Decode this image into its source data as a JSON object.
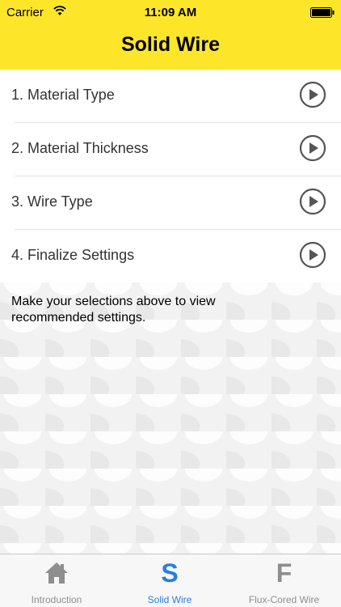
{
  "status": {
    "carrier": "Carrier",
    "time": "11:09 AM"
  },
  "header": {
    "title": "Solid Wire",
    "color": "#fde62a"
  },
  "steps": [
    {
      "label": "1. Material Type"
    },
    {
      "label": "2. Material Thickness"
    },
    {
      "label": "3. Wire Type"
    },
    {
      "label": "4. Finalize Settings"
    }
  ],
  "info": {
    "text": "Make your selections above to view recommended settings."
  },
  "tabs": [
    {
      "label": "Introduction",
      "glyph": "",
      "icon": "home-icon",
      "selected": false
    },
    {
      "label": "Solid Wire",
      "glyph": "S",
      "icon": "s-letter-icon",
      "selected": true
    },
    {
      "label": "Flux-Cored Wire",
      "glyph": "F",
      "icon": "f-letter-icon",
      "selected": false
    }
  ],
  "colors": {
    "accent": "#2a7de1",
    "inactive": "#8e8e8e"
  }
}
